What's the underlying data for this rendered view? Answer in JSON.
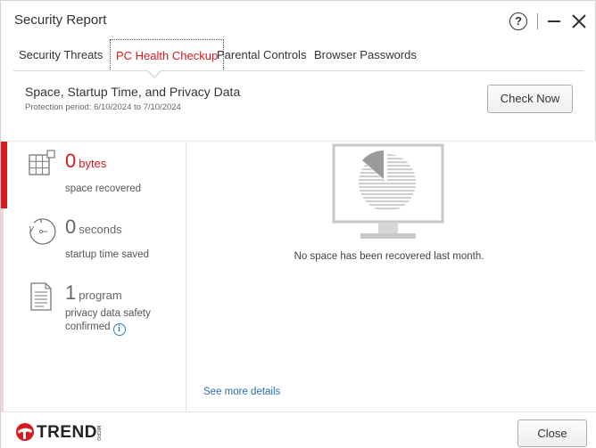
{
  "window": {
    "title": "Security Report"
  },
  "tabs": [
    {
      "label": "Security Threats",
      "active": false
    },
    {
      "label": "PC Health Checkup",
      "active": true
    },
    {
      "label": "Parental Controls",
      "active": false
    },
    {
      "label": "Browser Passwords",
      "active": false
    }
  ],
  "header": {
    "title": "Space, Startup Time, and Privacy Data",
    "period": "Protection period: 6/10/2024 to 7/10/2024",
    "check_now_label": "Check Now"
  },
  "stats": [
    {
      "icon": "grid-expand-icon",
      "value": "0",
      "unit": "bytes",
      "desc_line1": "space recovered",
      "desc_line2": "",
      "selected": true
    },
    {
      "icon": "stopwatch-icon",
      "value": "0",
      "unit": "seconds",
      "desc_line1": "startup time saved",
      "desc_line2": "",
      "selected": false
    },
    {
      "icon": "document-icon",
      "value": "1",
      "unit": "program",
      "desc_line1": "privacy data safety",
      "desc_line2": "confirmed",
      "selected": false
    }
  ],
  "main": {
    "empty_message": "No space has been recovered last month.",
    "see_more_label": "See more details"
  },
  "footer": {
    "brand": "TREND",
    "brand_sub": "MICRO",
    "close_label": "Close"
  },
  "colors": {
    "accent_red": "#d71920",
    "link_blue": "#2a6fb5"
  }
}
